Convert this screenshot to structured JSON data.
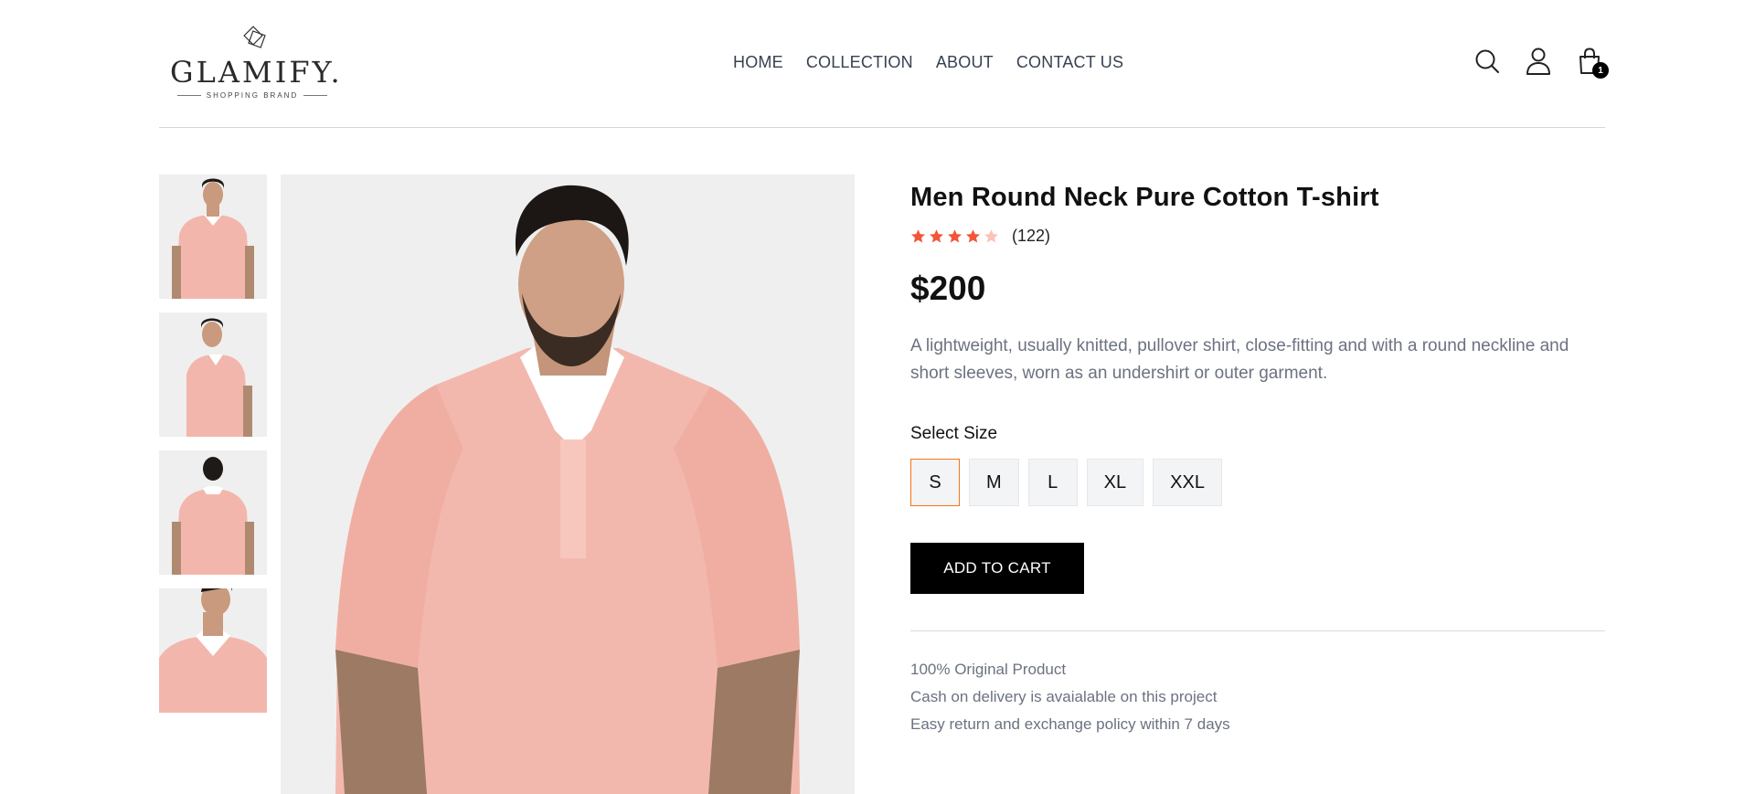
{
  "brand": {
    "name": "GLAMIFY.",
    "tagline": "SHOPPING BRAND"
  },
  "nav": {
    "items": [
      "HOME",
      "COLLECTION",
      "ABOUT",
      "CONTACT US"
    ]
  },
  "header_icons": {
    "search": "search-icon",
    "profile": "user-icon",
    "cart": "shopping-bag-icon",
    "cart_count": "1"
  },
  "gallery": {
    "thumbnail_count": 4,
    "main_image_alt": "Man wearing pink polo shirt"
  },
  "product": {
    "title": "Men Round Neck Pure Cotton T-shirt",
    "rating": 4,
    "rating_max": 5,
    "review_count": "(122)",
    "price": "$200",
    "description": "A lightweight, usually knitted, pullover shirt, close-fitting and with a round neckline and short sleeves, worn as an undershirt or outer garment.",
    "size_label": "Select Size",
    "sizes": [
      "S",
      "M",
      "L",
      "XL",
      "XXL"
    ],
    "selected_size": "S",
    "add_to_cart": "ADD TO CART",
    "features": [
      "100% Original Product",
      "Cash on delivery is avaialable on this project",
      "Easy return and exchange policy within 7 days"
    ]
  },
  "colors": {
    "star_filled": "#f4553a",
    "star_empty": "#fbc4b8",
    "accent_border": "#f97316",
    "button_bg": "#000000"
  }
}
